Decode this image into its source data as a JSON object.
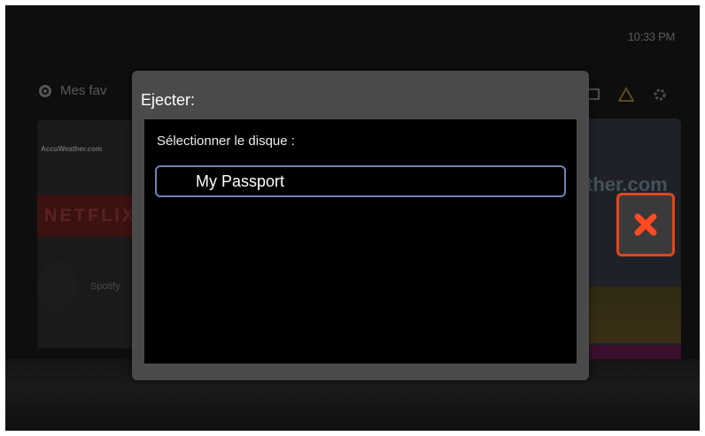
{
  "status": {
    "clock": "10:33 PM"
  },
  "background": {
    "favorites_label": "Mes fav",
    "accuweather_label": "AccuWeather.com",
    "netflix_label": "NETFLIX",
    "spotify_label": "Spotify",
    "weather_partial": "ther.com",
    "toolbar_icons": [
      "monitor-icon",
      "warning-icon",
      "gear-icon"
    ]
  },
  "dialog": {
    "title": "Ejecter:",
    "select_label": "Sélectionner le disque :",
    "disks": [
      {
        "label": "My Passport",
        "selected": true
      }
    ]
  },
  "close_button": {
    "icon": "close-icon",
    "accent": "#e0471e"
  },
  "colors": {
    "dialog_frame": "#4a4a4a",
    "dialog_body": "#000000",
    "selection_border": "#6f82b8"
  }
}
